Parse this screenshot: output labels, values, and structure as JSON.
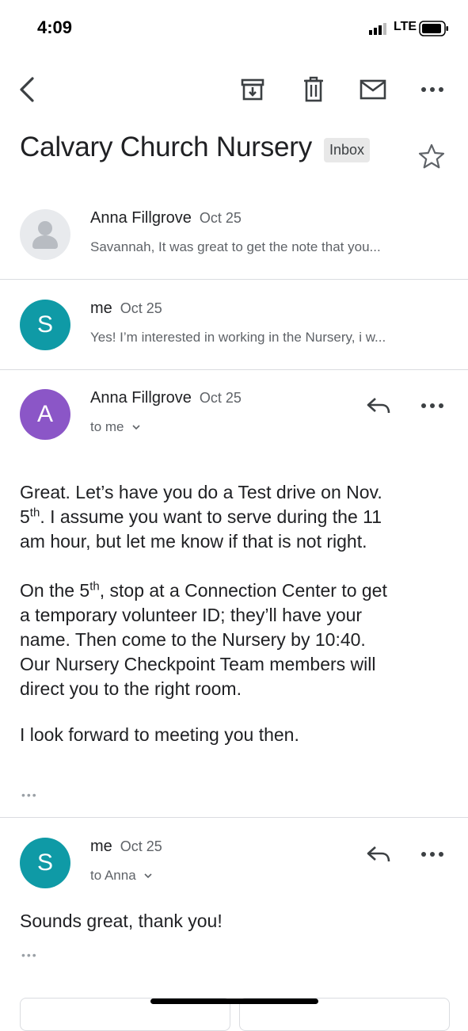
{
  "status_bar": {
    "time": "4:09",
    "network": "LTE"
  },
  "toolbar": {
    "icons": [
      "back-arrow-icon",
      "archive-icon",
      "trash-icon",
      "mail-icon",
      "more-icon"
    ]
  },
  "subject": {
    "title": "Calvary Church Nursery",
    "label": "Inbox"
  },
  "messages": [
    {
      "sender": "Anna Fillgrove",
      "date": "Oct 25",
      "snippet": "Savannah, It was great to get the note that you...",
      "avatar": "person-icon",
      "avatar_color": "#e8eaed"
    },
    {
      "sender": "me",
      "date": "Oct 25",
      "snippet": "Yes! I’m interested in working in the Nursery, i w...",
      "avatar_letter": "S",
      "avatar_color": "#0f9aa6"
    },
    {
      "sender": "Anna Fillgrove",
      "date": "Oct 25",
      "recipient": "to me",
      "avatar_letter": "A",
      "avatar_color": "#8b56c7",
      "body": {
        "p1_a": "Great. Let’s have you do a Test drive on Nov.",
        "p1_b": "5",
        "p1_sup": "th",
        "p1_c": ". I assume you want to serve during the 11",
        "p1_d": "am hour, but let me know if that is not right.",
        "p2_a": "On the 5",
        "p2_sup": "th",
        "p2_b": ", stop at a Connection Center to get",
        "p2_c": "a temporary volunteer ID; they’ll have your",
        "p2_d": "name. Then come to the Nursery by 10:40.",
        "p2_e": "Our Nursery Checkpoint Team members will",
        "p2_f": "direct you to the right room.",
        "p3": "I look forward to meeting you then."
      }
    },
    {
      "sender": "me",
      "date": "Oct 25",
      "recipient": "to Anna",
      "avatar_letter": "S",
      "avatar_color": "#0f9aa6",
      "body": {
        "p1": "Sounds great, thank you!"
      }
    }
  ],
  "ellipsis": "•••"
}
